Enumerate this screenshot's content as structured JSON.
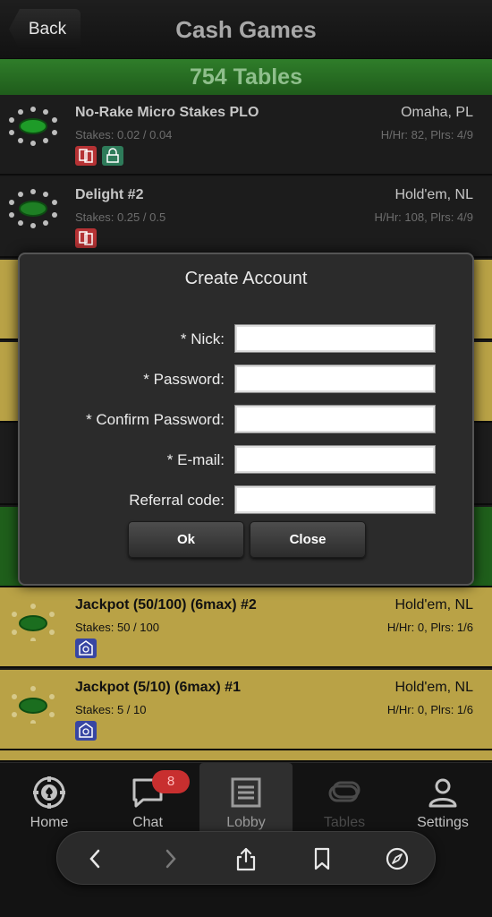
{
  "header": {
    "back_label": "Back",
    "title": "Cash Games"
  },
  "tables_count": "754 Tables",
  "rows": [
    {
      "name": "No-Rake Micro Stakes PLO",
      "stakes": "Stakes: 0.02 / 0.04",
      "game": "Omaha, PL",
      "info": "H/Hr: 82, Plrs: 4/9"
    },
    {
      "name": "Delight #2",
      "stakes": "Stakes: 0.25 / 0.5",
      "game": "Hold'em, NL",
      "info": "H/Hr: 108, Plrs: 4/9"
    },
    {
      "name": "Jackpot (50/100) (6max) #2",
      "stakes": "Stakes: 50 / 100",
      "game": "Hold'em, NL",
      "info": "H/Hr: 0, Plrs: 1/6"
    },
    {
      "name": "Jackpot (5/10) (6max) #1",
      "stakes": "Stakes: 5 / 10",
      "game": "Hold'em, NL",
      "info": "H/Hr: 0, Plrs: 1/6"
    }
  ],
  "modal": {
    "title": "Create Account",
    "nick_label": "* Nick:",
    "password_label": "* Password:",
    "confirm_label": "* Confirm Password:",
    "email_label": "* E-mail:",
    "referral_label": "Referral code:",
    "ok_label": "Ok",
    "close_label": "Close"
  },
  "tabs": {
    "home": "Home",
    "chat": "Chat",
    "lobby": "Lobby",
    "tables": "Tables",
    "settings": "Settings",
    "chat_badge": "8"
  },
  "colors": {
    "gold_row": "#b9a246",
    "green_bar": "#2f7d2a",
    "badge_red": "#c82f2f"
  }
}
